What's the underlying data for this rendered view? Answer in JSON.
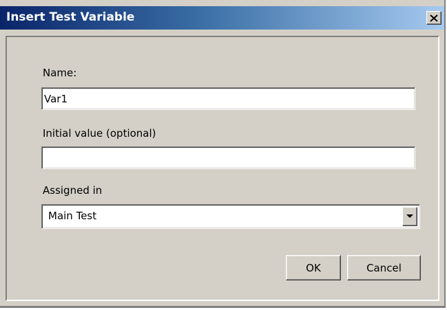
{
  "window": {
    "title": "Insert Test Variable",
    "close_icon": "close-icon"
  },
  "form": {
    "name_label": "Name:",
    "name_value": "Var1",
    "initial_value_label": "Initial value (optional)",
    "initial_value_value": "",
    "assigned_in_label": "Assigned in",
    "assigned_in_selected": "Main Test",
    "assigned_in_icon": "chevron-down-icon"
  },
  "buttons": {
    "ok_label": "OK",
    "cancel_label": "Cancel"
  },
  "colors": {
    "face": "#d4d0c8",
    "title_start": "#0a246a",
    "title_end": "#a6caf0"
  }
}
